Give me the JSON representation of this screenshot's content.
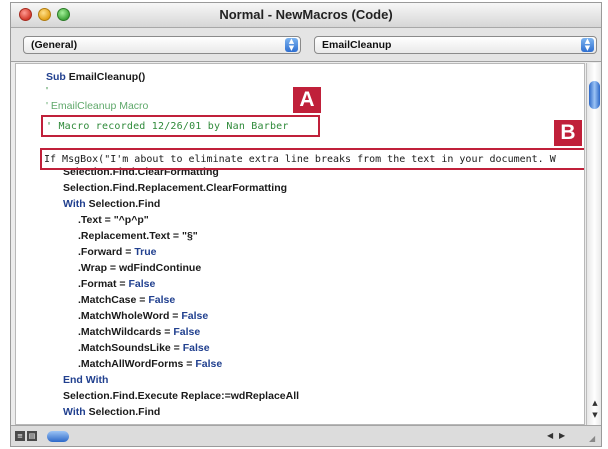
{
  "window": {
    "title": "Normal - NewMacros (Code)"
  },
  "dropdowns": {
    "object": "(General)",
    "procedure": "EmailCleanup"
  },
  "callouts": {
    "a": "A",
    "b": "B"
  },
  "code": {
    "sub_keyword": "Sub",
    "sub_name": " EmailCleanup()",
    "comment_blank": "'",
    "comment_title": "' EmailCleanup Macro",
    "comment_recorded": "' Macro recorded 12/26/01 by Nan Barber",
    "msgbox_line": "If MsgBox(\"I'm about to eliminate extra line breaks from the text in your document. W",
    "l_clear_format": "Selection.Find.ClearFormatting",
    "l_repl_clear": "Selection.Find.Replacement.ClearFormatting",
    "with_kw": "With",
    "with_target": " Selection.Find",
    "l_text": ".Text = \"^p^p\"",
    "l_repl_text": ".Replacement.Text = \"§\"",
    "l_forward": ".Forward = ",
    "v_true": "True",
    "l_wrap": ".Wrap = wdFindContinue",
    "l_format": ".Format = ",
    "v_false": "False",
    "l_matchcase": ".MatchCase = ",
    "l_wholeword": ".MatchWholeWord = ",
    "l_wildcards": ".MatchWildcards = ",
    "l_soundslike": ".MatchSoundsLike = ",
    "l_allforms": ".MatchAllWordForms = ",
    "end_with": "End With",
    "l_execute": "Selection.Find.Execute Replace:=wdReplaceAll",
    "with_find": "Selection.Find"
  }
}
